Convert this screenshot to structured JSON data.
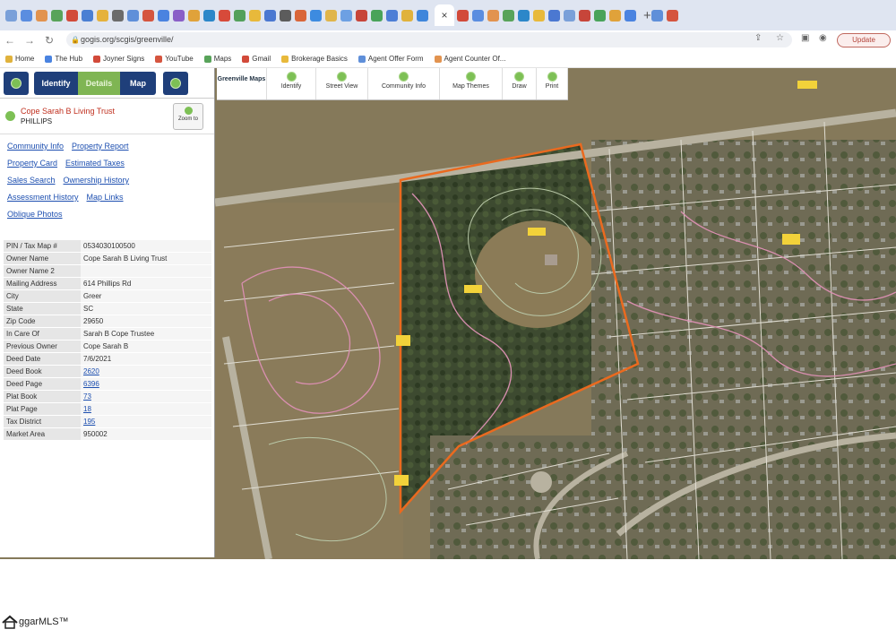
{
  "browser": {
    "tab_colors": [
      "#7aa0d9",
      "#5a8de0",
      "#e2934f",
      "#58a35a",
      "#d24a3a",
      "#4a7fd3",
      "#e5b23d",
      "#6b6b6b",
      "#5f8fd9",
      "#d5553f",
      "#4a83e0",
      "#8a5fc7",
      "#e0a23a",
      "#2c87c9",
      "#d74a3a",
      "#53a05b",
      "#e8b93b",
      "#4b78d1",
      "#5c5c5c",
      "#d9663a",
      "#3d8be0",
      "#e0b54a",
      "#6da0e3",
      "#c7453a",
      "#49a35a",
      "#4d7ed6",
      "#e0b23c",
      "#3f86db"
    ],
    "tab_colors_2": [
      "#d24a3a",
      "#5a8de0",
      "#e2934f",
      "#58a35a",
      "#2c87c9",
      "#e8b93b",
      "#4b78d1",
      "#7aa0d9",
      "#c7453a",
      "#49a35a",
      "#e0a23a",
      "#4a83e0"
    ],
    "tab_colors_3": [
      "#5f8fd9",
      "#d5553f",
      "#8a5fc7",
      "#e0b54a",
      "#3d8be0",
      "#d9663a",
      "#53a05b",
      "#6da0e3",
      "#e0b23c",
      "#4d7ed6"
    ],
    "active_tab_icon": "close-icon",
    "url": "gogis.org/scgis/greenville/",
    "update_label": "Update"
  },
  "bookmarks": [
    {
      "label": "Home",
      "color": "#e0b23c"
    },
    {
      "label": "The Hub",
      "color": "#4a83e0"
    },
    {
      "label": "Joyner Signs",
      "color": "#d24a3a"
    },
    {
      "label": "YouTube",
      "color": "#d5553f"
    },
    {
      "label": "Maps",
      "color": "#58a35a"
    },
    {
      "label": "Gmail",
      "color": "#d24a3a"
    },
    {
      "label": "Brokerage Basics",
      "color": "#e8b93b"
    },
    {
      "label": "Agent Offer Form",
      "color": "#5f8fd9"
    },
    {
      "label": "Agent Counter Of...",
      "color": "#e2934f"
    }
  ],
  "panel": {
    "identify_label": "Identify",
    "details_label": "Details",
    "map_label": "Map",
    "owner": "Cope Sarah B Living Trust",
    "road": "PHILLIPS",
    "zoom_label": "Zoom to",
    "links": [
      [
        "Community Info",
        "Property Report"
      ],
      [
        "Property Card",
        "Estimated Taxes"
      ],
      [
        "Sales Search",
        "Ownership History"
      ],
      [
        "Assessment History",
        "Map Links"
      ],
      [
        "Oblique Photos"
      ]
    ],
    "attributes": [
      {
        "key": "PIN / Tax Map #",
        "value": "0534030100500"
      },
      {
        "key": "Owner Name",
        "value": "Cope Sarah B Living Trust"
      },
      {
        "key": "Owner Name 2",
        "value": ""
      },
      {
        "key": "Mailing Address",
        "value": "614 Phillips Rd"
      },
      {
        "key": "City",
        "value": "Greer"
      },
      {
        "key": "State",
        "value": "SC"
      },
      {
        "key": "Zip Code",
        "value": "29650"
      },
      {
        "key": "In Care Of",
        "value": "Sarah B Cope Trustee"
      },
      {
        "key": "Previous Owner",
        "value": "Cope Sarah B"
      },
      {
        "key": "Deed Date",
        "value": "7/6/2021"
      },
      {
        "key": "Deed Book",
        "value": "2620",
        "link": true
      },
      {
        "key": "Deed Page",
        "value": "6396",
        "link": true
      },
      {
        "key": "Plat Book",
        "value": "73",
        "link": true
      },
      {
        "key": "Plat Page",
        "value": "18",
        "link": true
      },
      {
        "key": "Tax District",
        "value": "195",
        "link": true
      },
      {
        "key": "Market Area",
        "value": "950002"
      }
    ]
  },
  "toolbar": {
    "brand": "Greenville Maps",
    "items": [
      "Identify",
      "Street View",
      "Community Info",
      "Map Themes",
      "Draw",
      "Print"
    ]
  },
  "footer": {
    "logo_text": "ggarMLS™"
  }
}
